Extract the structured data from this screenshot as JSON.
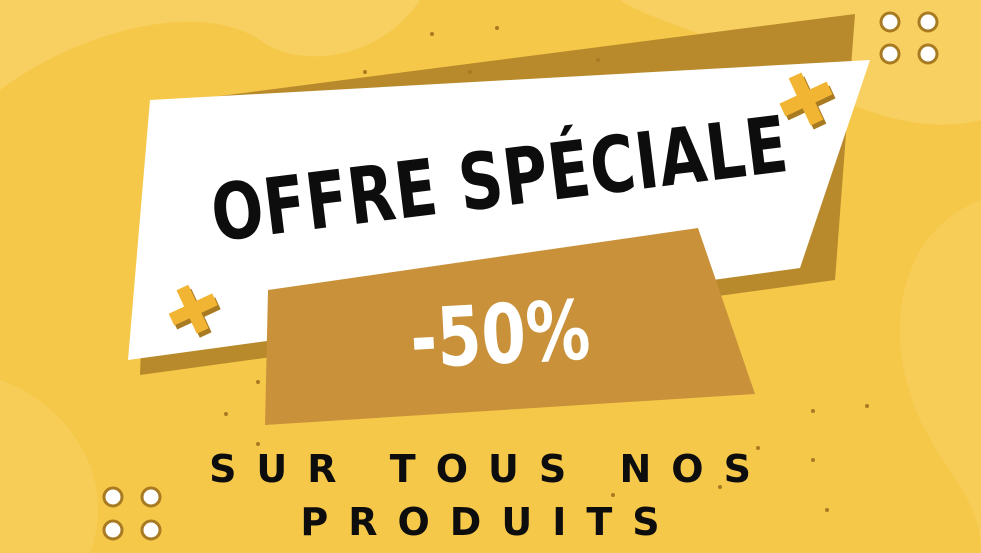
{
  "banner": {
    "headline": "OFFRE SPÉCIALE",
    "discount": "-50%",
    "subline_1": "SUR TOUS NOS",
    "subline_2": "PRODUITS"
  },
  "colors": {
    "background": "#f5c84a",
    "background_light": "#f8d061",
    "banner_shadow": "#b88a2b",
    "banner_white": "#ffffff",
    "discount_box": "#c9923a",
    "plus_gold": "#f2b533",
    "text_dark": "#0d0d0d"
  }
}
